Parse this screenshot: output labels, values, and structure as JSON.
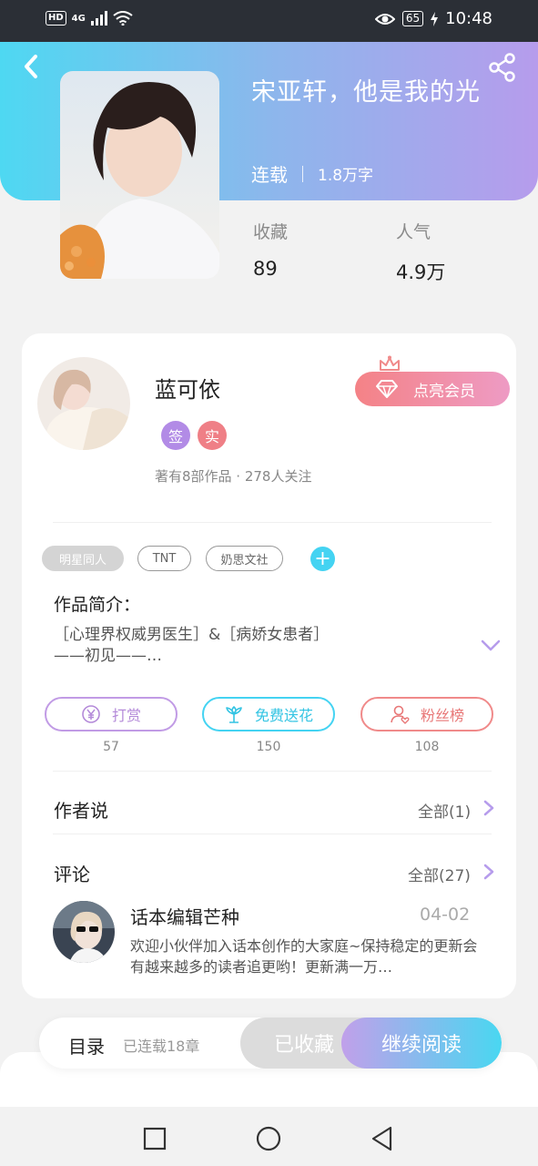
{
  "status_bar": {
    "hd": "HD",
    "signal": "4G",
    "battery": "65",
    "time": "10:48"
  },
  "book": {
    "title": "宋亚轩，他是我的光",
    "status": "连载",
    "words": "1.8万字",
    "favorites_label": "收藏",
    "favorites": "89",
    "popularity_label": "人气",
    "popularity": "4.9万"
  },
  "author": {
    "name": "蓝可依",
    "badge_sign": "签",
    "badge_real": "实",
    "stats": "著有8部作品 · 278人关注",
    "vip_label": "点亮会员"
  },
  "tags": [
    "明星同人",
    "TNT",
    "奶思文社"
  ],
  "intro": {
    "label": "作品简介：",
    "text_line1": "［心理界权威男医生］&［病娇女患者］",
    "text_line2": "——初见——…"
  },
  "actions": [
    {
      "label": "打赏",
      "count": "57",
      "icon": "yen-icon"
    },
    {
      "label": "免费送花",
      "count": "150",
      "icon": "flower-icon"
    },
    {
      "label": "粉丝榜",
      "count": "108",
      "icon": "user-heart-icon"
    }
  ],
  "author_says": {
    "title": "作者说",
    "all": "全部(1)"
  },
  "comments": {
    "title": "评论",
    "all": "全部(27)",
    "items": [
      {
        "user": "话本编辑芒种",
        "date": "04-02",
        "text": "欢迎小伙伴加入话本创作的大家庭~保持稳定的更新会有越来越多的读者追更哟！更新满一万…"
      }
    ]
  },
  "bottom_bar": {
    "toc": "目录",
    "toc_status": "已连载18章",
    "fav": "已收藏",
    "read": "继续阅读"
  },
  "colors": {
    "accent_cyan": "#44d3f2",
    "accent_purple": "#b69cec",
    "vip_pink": "#f48286"
  }
}
